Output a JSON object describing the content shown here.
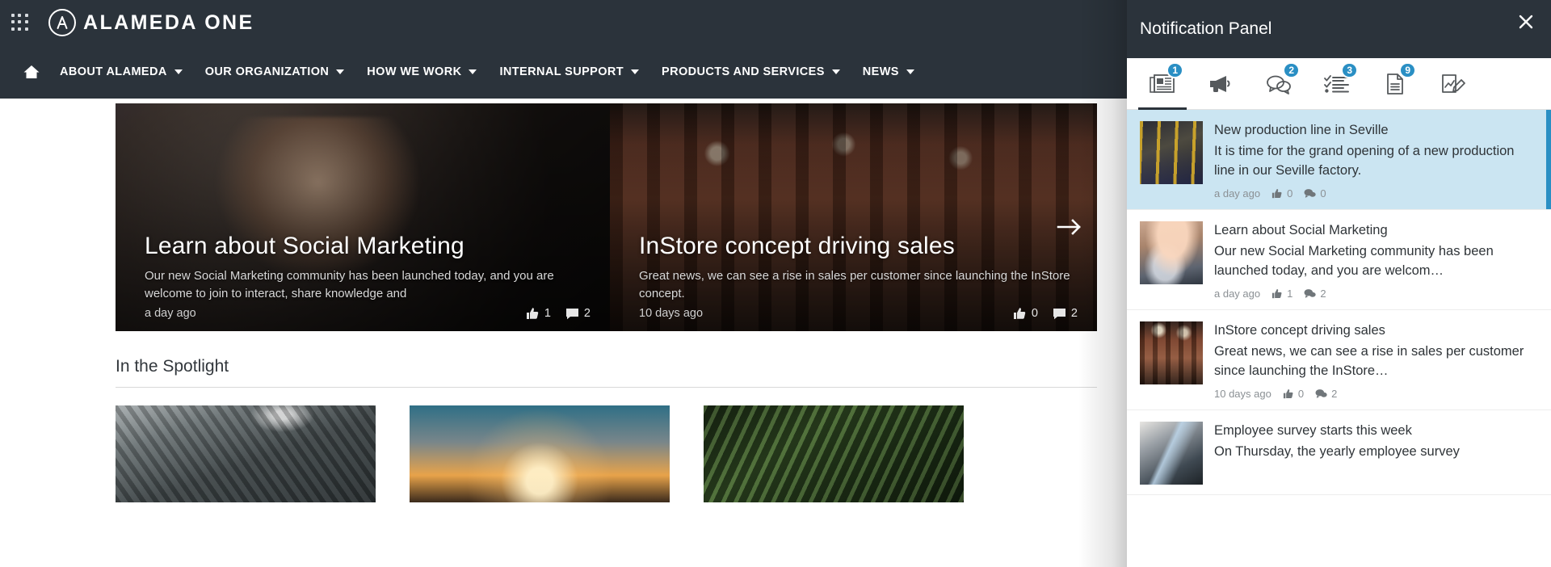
{
  "brand": {
    "name": "ALAMEDA ONE",
    "apps_icon": "grid-apps-icon",
    "logo_icon": "alameda-logo-icon"
  },
  "nav": {
    "home_icon": "home-icon",
    "items": [
      {
        "label": "ABOUT ALAMEDA",
        "has_caret": true
      },
      {
        "label": "OUR ORGANIZATION",
        "has_caret": true
      },
      {
        "label": "HOW WE WORK",
        "has_caret": true
      },
      {
        "label": "INTERNAL SUPPORT",
        "has_caret": true
      },
      {
        "label": "PRODUCTS AND SERVICES",
        "has_caret": true
      },
      {
        "label": "NEWS",
        "has_caret": true
      }
    ]
  },
  "carousel": {
    "next_icon": "arrow-right-icon",
    "slides": [
      {
        "title": "Learn about Social Marketing",
        "description": "Our new Social Marketing community has been launched today, and you are welcome to join to interact, share knowledge and",
        "time": "a day ago",
        "likes": "1",
        "comments": "2"
      },
      {
        "title": "InStore concept driving sales",
        "description": "Great news, we can see a rise in sales per customer since launching the InStore concept.",
        "time": "10 days ago",
        "likes": "0",
        "comments": "2"
      }
    ]
  },
  "spotlight": {
    "heading": "In the Spotlight",
    "cards": [
      {
        "image": "climber-photo"
      },
      {
        "image": "sunset-jumpers-photo"
      },
      {
        "image": "forest-ferns-photo"
      }
    ]
  },
  "notification_panel": {
    "title": "Notification Panel",
    "close_icon": "close-icon",
    "accent_color": "#2a8fc4",
    "header_color": "#2b333b",
    "unread_row_color": "#cbe5f2",
    "tabs": [
      {
        "icon": "newspaper-icon",
        "badge": "1",
        "active": true
      },
      {
        "icon": "megaphone-icon",
        "badge": "",
        "active": false
      },
      {
        "icon": "chat-bubbles-icon",
        "badge": "2",
        "active": false
      },
      {
        "icon": "checklist-icon",
        "badge": "3",
        "active": false
      },
      {
        "icon": "document-icon",
        "badge": "9",
        "active": false
      },
      {
        "icon": "signature-edit-icon",
        "badge": "",
        "active": false
      }
    ],
    "items": [
      {
        "title": "New production line in Seville",
        "description": "It is time for the grand opening of a new production line in our Seville factory.",
        "time": "a day ago",
        "likes": "0",
        "comments": "0",
        "unread": true,
        "thumb": "factory-photo"
      },
      {
        "title": "Learn about Social Marketing",
        "description": "Our new Social Marketing community has been launched today, and you are welcom…",
        "time": "a day ago",
        "likes": "1",
        "comments": "2",
        "unread": false,
        "thumb": "woman-phone-photo"
      },
      {
        "title": "InStore concept driving sales",
        "description": "Great news, we can see a rise in sales per customer since launching the InStore…",
        "time": "10 days ago",
        "likes": "0",
        "comments": "2",
        "unread": false,
        "thumb": "store-interior-photo"
      },
      {
        "title": "Employee survey starts this week",
        "description": "On Thursday, the yearly employee survey",
        "time": "",
        "likes": "",
        "comments": "",
        "unread": false,
        "thumb": "laptop-meeting-photo"
      }
    ]
  }
}
